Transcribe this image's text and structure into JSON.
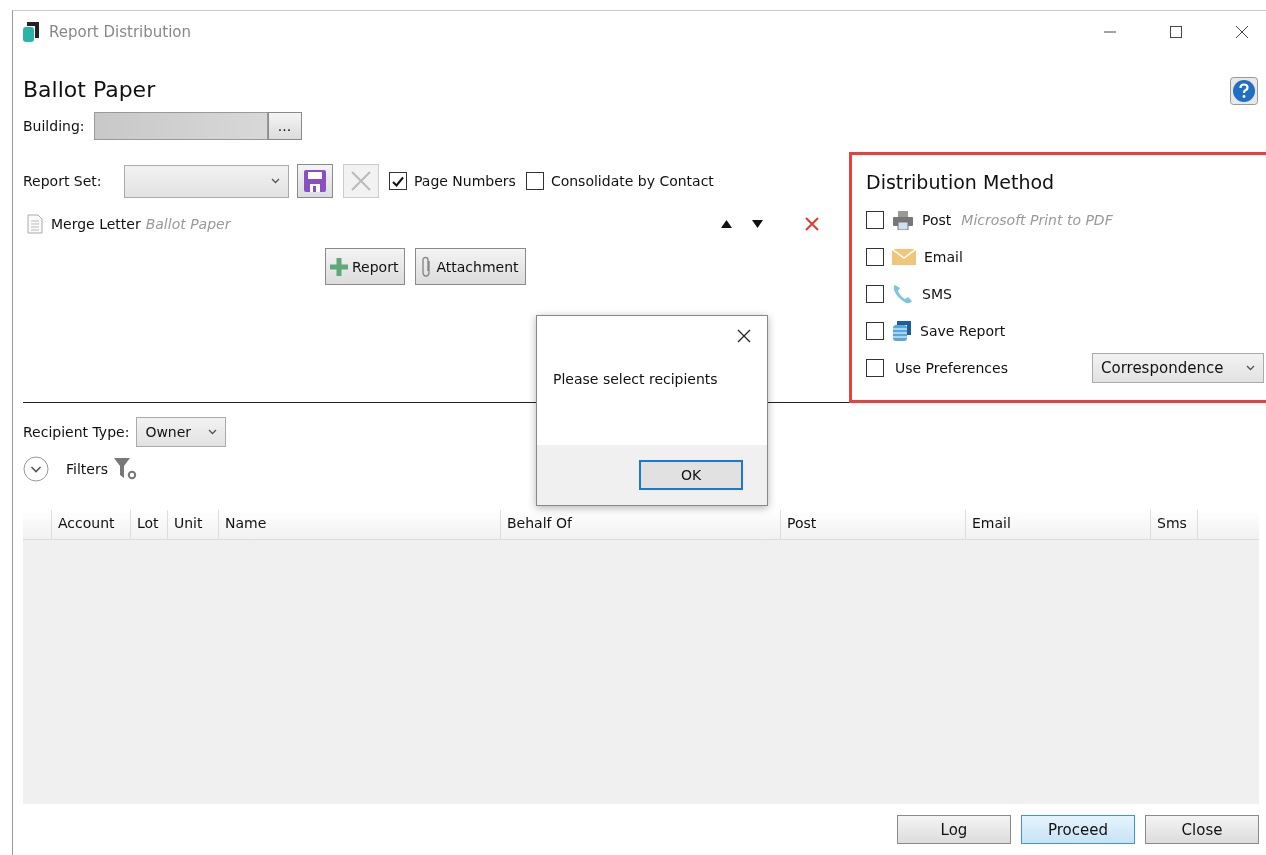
{
  "window": {
    "title": "Report Distribution"
  },
  "heading": "Ballot Paper",
  "building": {
    "label": "Building:",
    "button": "..."
  },
  "report_set": {
    "label": "Report Set:",
    "options": [
      {
        "label": "Page Numbers",
        "checked": true
      },
      {
        "label": "Consolidate by Contact",
        "checked": false
      }
    ]
  },
  "reports": [
    {
      "type": "Merge Letter",
      "name": "Ballot Paper"
    }
  ],
  "add_buttons": [
    {
      "kind": "report",
      "label": "Report"
    },
    {
      "kind": "attachment",
      "label": "Attachment"
    }
  ],
  "distribution": {
    "title": "Distribution Method",
    "highlighted": true,
    "options": [
      {
        "kind": "post",
        "label": "Post",
        "detail": "Microsoft Print to PDF",
        "checked": false
      },
      {
        "kind": "email",
        "label": "Email",
        "checked": false
      },
      {
        "kind": "sms",
        "label": "SMS",
        "checked": false
      },
      {
        "kind": "save",
        "label": "Save Report",
        "checked": false
      },
      {
        "kind": "preferences",
        "label": "Use Preferences",
        "checked": false,
        "select": "Correspondence"
      }
    ]
  },
  "recipient_type": {
    "label": "Recipient Type:",
    "value": "Owner"
  },
  "filters": {
    "label": "Filters",
    "expanded": false
  },
  "table": {
    "columns": [
      "Account",
      "Lot",
      "Unit",
      "Name",
      "Behalf Of",
      "Post",
      "Email",
      "Sms"
    ]
  },
  "footer_buttons": [
    {
      "label": "Log",
      "default": false
    },
    {
      "label": "Proceed",
      "default": true
    },
    {
      "label": "Close",
      "default": false
    }
  ],
  "dialog": {
    "message": "Please select recipients",
    "button": "OK"
  }
}
